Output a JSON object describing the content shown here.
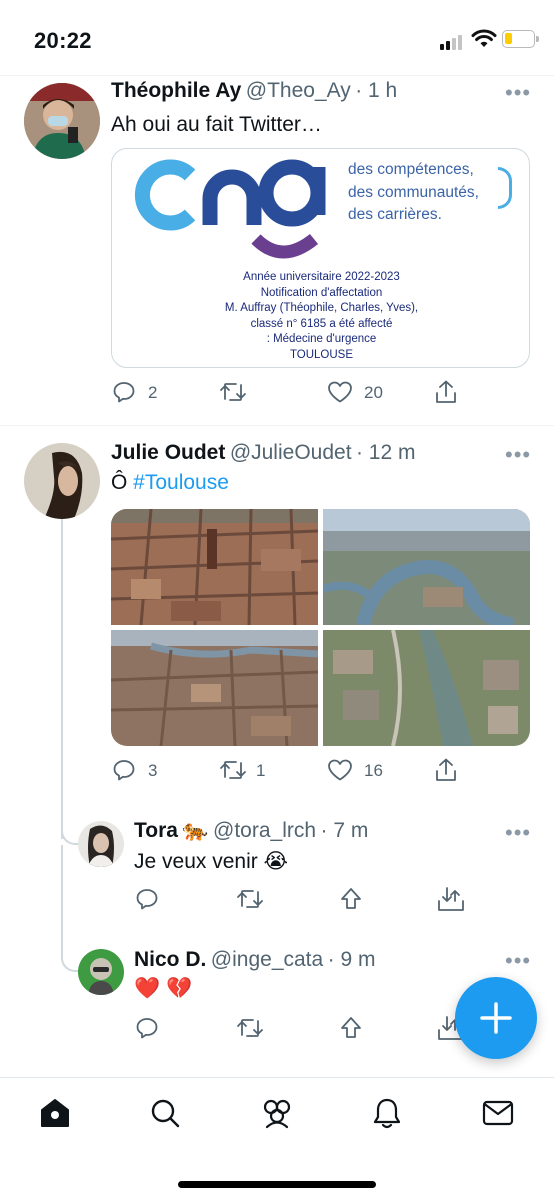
{
  "status_bar": {
    "time": "20:22",
    "battery_color": "#ffcc00"
  },
  "colors": {
    "accent": "#1d9bf0",
    "secondary_text": "#536471",
    "border": "#cfd9de"
  },
  "tweets": [
    {
      "name": "Théophile Ay",
      "handle": "@Theo_Ay",
      "time": "· 1 h",
      "text": "Ah oui au fait Twitter…",
      "more": "•••",
      "card": {
        "logo_text": "cng",
        "tagline": [
          "des compétences,",
          "des communautés,",
          "des carrières."
        ],
        "notice": [
          "Année universitaire 2022-2023",
          "Notification d'affectation",
          "M. Auffray (Théophile, Charles, Yves),",
          "classé n° 6185 a été affecté",
          ": Médecine d'urgence",
          "TOULOUSE"
        ]
      },
      "stats": {
        "replies": "2",
        "retweets": "",
        "likes": "20"
      }
    },
    {
      "name": "Julie Oudet",
      "handle": "@JulieOudet",
      "time": "· 12 m",
      "text_prefix": "Ô ",
      "hashtag": "#Toulouse",
      "more": "•••",
      "photos": [
        "aerial-city-center",
        "aerial-river-bend",
        "aerial-old-town",
        "aerial-garonne-river"
      ],
      "stats": {
        "replies": "3",
        "retweets": "1",
        "likes": "16"
      }
    }
  ],
  "replies": [
    {
      "name": "Tora",
      "emoji_after_name": "🐅",
      "handle": "@tora_lrch",
      "time": "· 7 m",
      "text": "Je veux venir 😭",
      "more": "•••"
    },
    {
      "name": "Nico D.",
      "handle": "@inge_cata",
      "time": "· 9 m",
      "text": "❤️ 💔",
      "more": "•••"
    }
  ],
  "fab": {
    "label": "+",
    "icon": "plus-icon"
  },
  "tabbar": {
    "items": [
      "home-icon",
      "search-icon",
      "communities-icon",
      "notifications-icon",
      "messages-icon"
    ]
  }
}
